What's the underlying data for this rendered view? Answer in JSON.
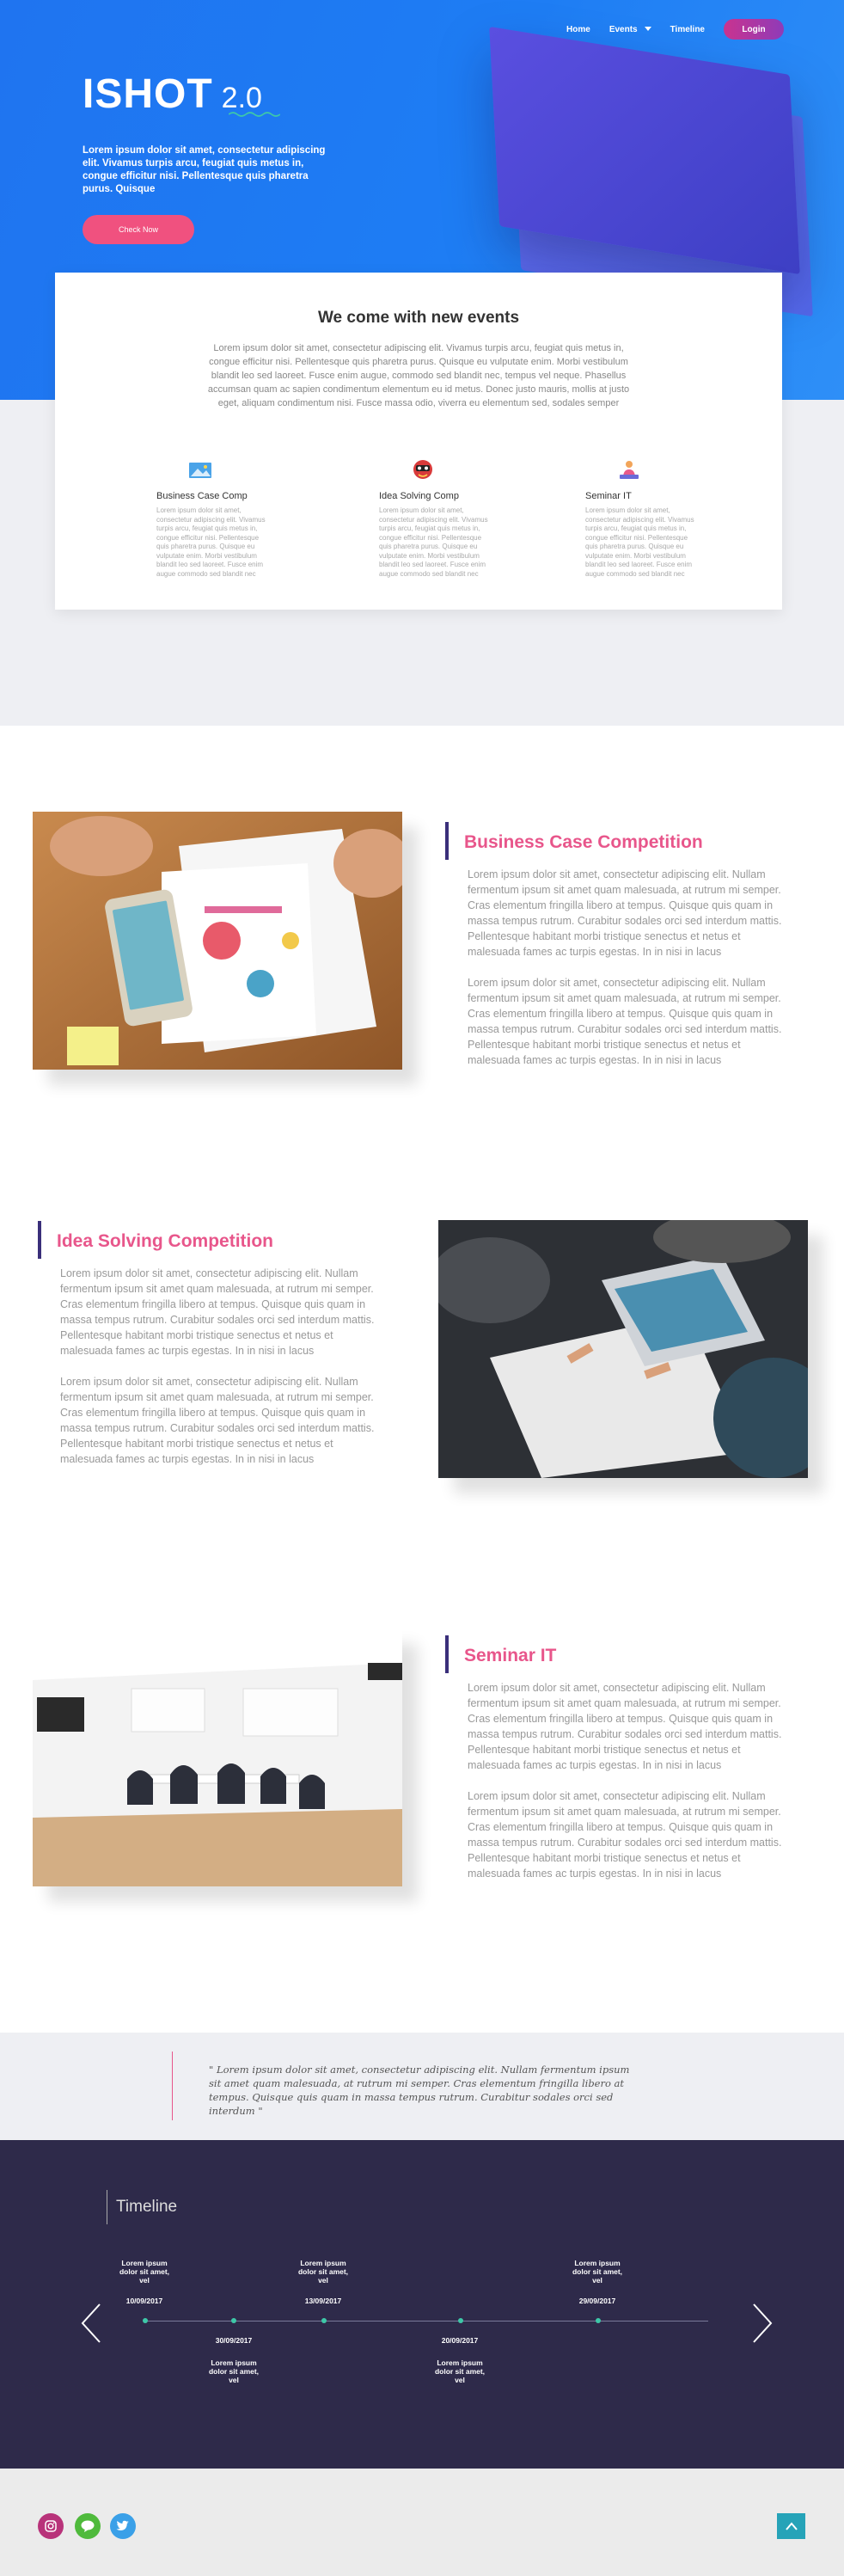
{
  "nav": {
    "items": [
      "Home",
      "Events",
      "Timeline"
    ],
    "login": "Login"
  },
  "hero": {
    "logo_main": "ISHOT",
    "logo_version": "2.0",
    "tagline": "Lorem ipsum dolor sit amet, consectetur adipiscing elit. Vivamus turpis arcu, feugiat quis metus in, congue efficitur nisi. Pellentesque quis pharetra purus. Quisque",
    "cta": "Check Now"
  },
  "events": {
    "title": "We come with new events",
    "description": "Lorem ipsum dolor sit amet, consectetur adipiscing elit. Vivamus turpis arcu, feugiat quis metus in, congue efficitur nisi. Pellentesque quis pharetra purus. Quisque eu vulputate enim. Morbi vestibulum blandit leo sed laoreet. Fusce enim augue, commodo sed blandit nec, tempus vel neque. Phasellus accumsan quam ac sapien condimentum elementum eu id metus. Donec justo mauris, mollis at justo eget, aliquam condimentum nisi. Fusce massa odio, viverra eu elementum sed, sodales semper",
    "features": [
      {
        "title": "Business Case Comp",
        "icon": "landscape-image-icon",
        "desc": "Lorem ipsum dolor sit amet, consectetur adipiscing elit. Vivamus turpis arcu, feugiat quis metus in, congue efficitur nisi. Pellentesque quis pharetra purus. Quisque eu vulputate enim. Morbi vestibulum blandit leo sed laoreet. Fusce enim augue commodo sed blandit nec"
      },
      {
        "title": "Idea Solving Comp",
        "icon": "mask-icon",
        "desc": "Lorem ipsum dolor sit amet, consectetur adipiscing elit. Vivamus turpis arcu, feugiat quis metus in, congue efficitur nisi. Pellentesque quis pharetra purus. Quisque eu vulputate enim. Morbi vestibulum blandit leo sed laoreet. Fusce enim augue commodo sed blandit nec"
      },
      {
        "title": "Seminar IT",
        "icon": "presenter-icon",
        "desc": "Lorem ipsum dolor sit amet, consectetur adipiscing elit. Vivamus turpis arcu, feugiat quis metus in, congue efficitur nisi. Pellentesque quis pharetra purus. Quisque eu vulputate enim. Morbi vestibulum blandit leo sed laoreet. Fusce enim augue commodo sed blandit nec"
      }
    ]
  },
  "articles": [
    {
      "title": "Business Case Competition",
      "p1": "Lorem ipsum dolor sit amet, consectetur adipiscing elit. Nullam fermentum ipsum sit amet quam malesuada, at rutrum mi semper. Cras elementum fringilla libero at tempus. Quisque quis quam in massa tempus rutrum. Curabitur sodales orci sed interdum mattis. Pellentesque habitant morbi tristique senectus et netus et malesuada fames ac turpis egestas. In in nisi in lacus",
      "p2": "Lorem ipsum dolor sit amet, consectetur adipiscing elit. Nullam fermentum ipsum sit amet quam malesuada, at rutrum mi semper. Cras elementum fringilla libero at tempus. Quisque quis quam in massa tempus rutrum. Curabitur sodales orci sed interdum mattis. Pellentesque habitant morbi tristique senectus et netus et malesuada fames ac turpis egestas. In in nisi in lacus"
    },
    {
      "title": "Idea Solving Competition",
      "p1": "Lorem ipsum dolor sit amet, consectetur adipiscing elit. Nullam fermentum ipsum sit amet quam malesuada, at rutrum mi semper. Cras elementum fringilla libero at tempus. Quisque quis quam in massa tempus rutrum. Curabitur sodales orci sed interdum mattis. Pellentesque habitant morbi tristique senectus et netus et malesuada fames ac turpis egestas. In in nisi in lacus",
      "p2": "Lorem ipsum dolor sit amet, consectetur adipiscing elit. Nullam fermentum ipsum sit amet quam malesuada, at rutrum mi semper. Cras elementum fringilla libero at tempus. Quisque quis quam in massa tempus rutrum. Curabitur sodales orci sed interdum mattis. Pellentesque habitant morbi tristique senectus et netus et malesuada fames ac turpis egestas. In in nisi in lacus"
    },
    {
      "title": "Seminar IT",
      "p1": "Lorem ipsum dolor sit amet, consectetur adipiscing elit. Nullam fermentum ipsum sit amet quam malesuada, at rutrum mi semper. Cras elementum fringilla libero at tempus. Quisque quis quam in massa tempus rutrum. Curabitur sodales orci sed interdum mattis. Pellentesque habitant morbi tristique senectus et netus et malesuada fames ac turpis egestas. In in nisi in lacus",
      "p2": "Lorem ipsum dolor sit amet, consectetur adipiscing elit. Nullam fermentum ipsum sit amet quam malesuada, at rutrum mi semper. Cras elementum fringilla libero at tempus. Quisque quis quam in massa tempus rutrum. Curabitur sodales orci sed interdum mattis. Pellentesque habitant morbi tristique senectus et netus et malesuada fames ac turpis egestas. In in nisi in lacus"
    }
  ],
  "quote": "\" Lorem ipsum dolor sit amet, consectetur adipiscing elit. Nullam fermentum ipsum sit amet quam malesuada, at rutrum mi semper. Cras elementum fringilla libero at tempus. Quisque quis quam in massa tempus rutrum. Curabitur sodales orci sed interdum \"",
  "timeline": {
    "title": "Timeline",
    "events": [
      {
        "label": "Lorem ipsum dolor sit amet, vel",
        "date": "10/09/2017"
      },
      {
        "label": "Lorem ipsum dolor sit amet, vel",
        "date": "30/09/2017"
      },
      {
        "label": "Lorem ipsum dolor sit amet, vel",
        "date": "13/09/2017"
      },
      {
        "label": "Lorem ipsum dolor sit amet, vel",
        "date": "20/09/2017"
      },
      {
        "label": "Lorem ipsum dolor sit amet, vel",
        "date": "29/09/2017"
      }
    ]
  },
  "footer": {
    "social": [
      "instagram-icon",
      "line-chat-icon",
      "twitter-icon"
    ]
  },
  "colors": {
    "hero_blue": "#1f74f0",
    "accent_pink": "#e8568b",
    "timeline_bg": "#2e2a4a",
    "teal": "#26a3b8"
  }
}
